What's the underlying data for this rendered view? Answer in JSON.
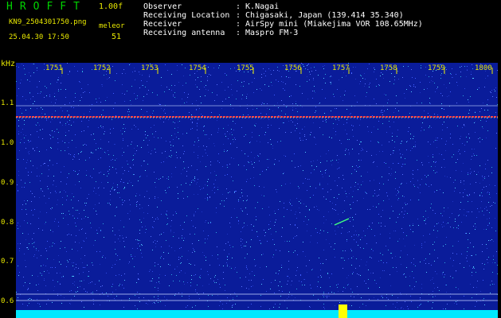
{
  "header": {
    "logo": "HROFFT",
    "version": "1.00f",
    "filename": "KN9_2504301750.png",
    "meteor_label": "meleor",
    "datetime": "25.04.30 17:50",
    "meteor_count": "51"
  },
  "station": [
    {
      "key": "Observer",
      "value": ": K.Nagai"
    },
    {
      "key": "Receiving Location",
      "value": ": Chigasaki, Japan (139.414 35.340)"
    },
    {
      "key": "Receiver",
      "value": ": AirSpy mini (Miakejima VOR 108.65MHz)"
    },
    {
      "key": "Receiving antenna",
      "value": ": Maspro FM-3"
    }
  ],
  "axes": {
    "y_unit": "kHz",
    "y_ticks": [
      "1.1",
      "1.0",
      "0.9",
      "0.8",
      "0.7",
      "0.6"
    ],
    "x_ticks": [
      "1751",
      "1752",
      "1753",
      "1754",
      "1755",
      "1756",
      "1757",
      "1758",
      "1759",
      "1800"
    ]
  },
  "colors": {
    "background": "#000000",
    "spectrogram": "#0a1c9a",
    "header_text": "#e8e800",
    "logo": "#00d400",
    "carrier": "#ff4040",
    "baseline": "#00e8ff"
  }
}
